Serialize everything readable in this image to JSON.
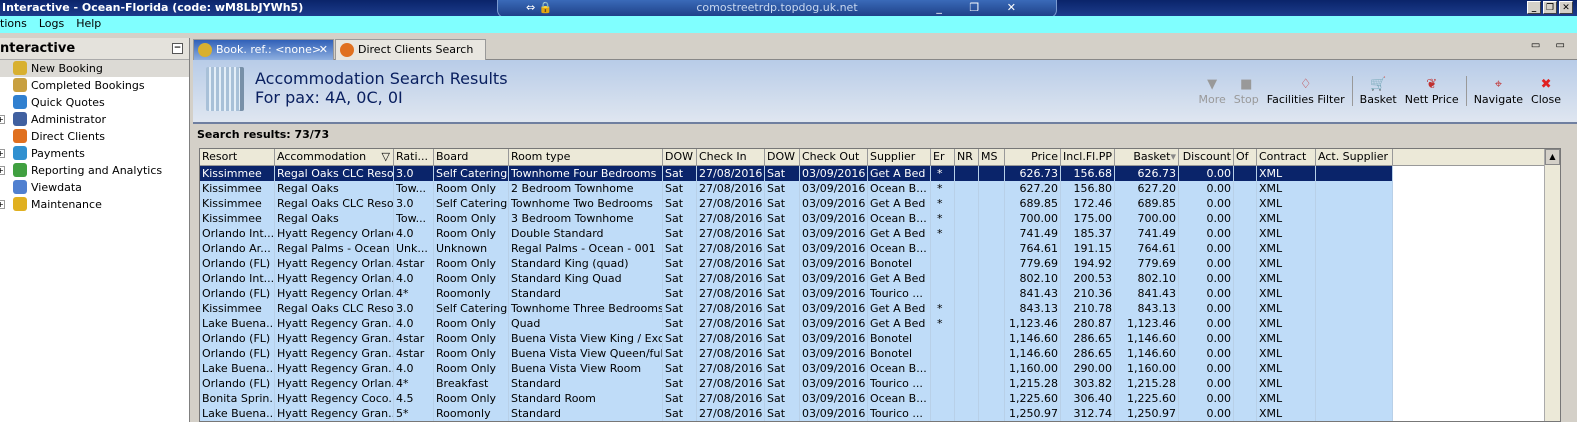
{
  "window": {
    "title": "Interactive - Ocean-Florida (code: wM8LbJYWh5)",
    "controls": [
      "_",
      "❐",
      "✕"
    ]
  },
  "rdp": {
    "host": "comostreetrdp.topdog.uk.net",
    "left": "⇔ 🔒",
    "right": "_ ❐ ✕"
  },
  "menu": [
    "tions",
    "Logs",
    "Help"
  ],
  "sidebar": {
    "title": "nteractive",
    "collapse": "−",
    "items": [
      {
        "label": "New Booking",
        "color": "#d8b030",
        "exp": false
      },
      {
        "label": "Completed Bookings",
        "color": "#c8a040",
        "exp": false
      },
      {
        "label": "Quick Quotes",
        "color": "#3080d0",
        "exp": false
      },
      {
        "label": "Administrator",
        "color": "#4060a0",
        "exp": true
      },
      {
        "label": "Direct Clients",
        "color": "#e07020",
        "exp": false
      },
      {
        "label": "Payments",
        "color": "#3090d0",
        "exp": true
      },
      {
        "label": "Reporting and Analytics",
        "color": "#40a040",
        "exp": true
      },
      {
        "label": "Viewdata",
        "color": "#5080d0",
        "exp": false
      },
      {
        "label": "Maintenance",
        "color": "#e0b020",
        "exp": true
      }
    ]
  },
  "tabs": [
    {
      "label": "Book. ref.: <none>",
      "close": "✕"
    },
    {
      "label": "Direct Clients Search"
    }
  ],
  "tab_controls": "▭ ▭",
  "header": {
    "title": "Accommodation Search Results",
    "subtitle": "For pax: 4A, 0C, 0I"
  },
  "toolbar": [
    {
      "label": "More",
      "icon": "▼",
      "disabled": true
    },
    {
      "label": "Stop",
      "icon": "■",
      "disabled": true
    },
    {
      "label": "Facilities Filter",
      "icon": "♢",
      "disabled": false,
      "sep": true
    },
    {
      "label": "Basket",
      "icon": "🛒",
      "disabled": false
    },
    {
      "label": "Nett Price",
      "icon": "❦",
      "disabled": false,
      "sep": true
    },
    {
      "label": "Navigate",
      "icon": "⌖",
      "disabled": false
    },
    {
      "label": "Close",
      "icon": "✖",
      "disabled": false,
      "color": "#e02020"
    }
  ],
  "search_results": "Search results: 73/73",
  "grid": {
    "columns": [
      "Resort",
      "Accommodation",
      "Rati...",
      "Board",
      "Room type",
      "DOW",
      "Check In",
      "DOW",
      "Check Out",
      "Supplier",
      "Er",
      "NR",
      "MS",
      "Price",
      "Incl.Fl.PP",
      "Basket",
      "Discount",
      "Of",
      "Contract",
      "Act. Supplier"
    ],
    "rows": [
      [
        "Kissimmee",
        "Regal Oaks CLC Resort",
        "3.0",
        "Self Catering",
        "Townhome Four Bedrooms",
        "Sat",
        "27/08/2016",
        "Sat",
        "03/09/2016",
        "Get A Bed",
        "*",
        "",
        "",
        "626.73",
        "156.68",
        "626.73",
        "0.00",
        "",
        "XML",
        ""
      ],
      [
        "Kissimmee",
        "Regal Oaks",
        "Tow...",
        "Room Only",
        "2 Bedroom Townhome",
        "Sat",
        "27/08/2016",
        "Sat",
        "03/09/2016",
        "Ocean B...",
        "*",
        "",
        "",
        "627.20",
        "156.80",
        "627.20",
        "0.00",
        "",
        "XML",
        ""
      ],
      [
        "Kissimmee",
        "Regal Oaks CLC Resort",
        "3.0",
        "Self Catering",
        "Townhome Two Bedrooms",
        "Sat",
        "27/08/2016",
        "Sat",
        "03/09/2016",
        "Get A Bed",
        "*",
        "",
        "",
        "689.85",
        "172.46",
        "689.85",
        "0.00",
        "",
        "XML",
        ""
      ],
      [
        "Kissimmee",
        "Regal Oaks",
        "Tow...",
        "Room Only",
        "3 Bedroom Townhome",
        "Sat",
        "27/08/2016",
        "Sat",
        "03/09/2016",
        "Ocean B...",
        "*",
        "",
        "",
        "700.00",
        "175.00",
        "700.00",
        "0.00",
        "",
        "XML",
        ""
      ],
      [
        "Orlando Int...",
        "Hyatt Regency Orlando",
        "4.0",
        "Room Only",
        "Double Standard",
        "Sat",
        "27/08/2016",
        "Sat",
        "03/09/2016",
        "Get A Bed",
        "*",
        "",
        "",
        "741.49",
        "185.37",
        "741.49",
        "0.00",
        "",
        "XML",
        ""
      ],
      [
        "Orlando Ar...",
        "Regal Palms - Ocean ...",
        "Unk...",
        "Unknown",
        "Regal Palms - Ocean - 001",
        "Sat",
        "27/08/2016",
        "Sat",
        "03/09/2016",
        "Ocean B...",
        "",
        "",
        "",
        "764.61",
        "191.15",
        "764.61",
        "0.00",
        "",
        "XML",
        ""
      ],
      [
        "Orlando (FL)",
        "Hyatt Regency Orlan...",
        "4star",
        "Room Only",
        "Standard King (quad)",
        "Sat",
        "27/08/2016",
        "Sat",
        "03/09/2016",
        "Bonotel",
        "",
        "",
        "",
        "779.69",
        "194.92",
        "779.69",
        "0.00",
        "",
        "XML",
        ""
      ],
      [
        "Orlando Int...",
        "Hyatt Regency Orlan...",
        "4.0",
        "Room Only",
        "Standard King Quad",
        "Sat",
        "27/08/2016",
        "Sat",
        "03/09/2016",
        "Get A Bed",
        "",
        "",
        "",
        "802.10",
        "200.53",
        "802.10",
        "0.00",
        "",
        "XML",
        ""
      ],
      [
        "Orlando (FL)",
        "Hyatt Regency Orlan...",
        "4*",
        "Roomonly",
        "Standard",
        "Sat",
        "27/08/2016",
        "Sat",
        "03/09/2016",
        "Tourico ...",
        "",
        "",
        "",
        "841.43",
        "210.36",
        "841.43",
        "0.00",
        "",
        "XML",
        ""
      ],
      [
        "Kissimmee",
        "Regal Oaks CLC Resort",
        "3.0",
        "Self Catering",
        "Townhome Three Bedrooms",
        "Sat",
        "27/08/2016",
        "Sat",
        "03/09/2016",
        "Get A Bed",
        "*",
        "",
        "",
        "843.13",
        "210.78",
        "843.13",
        "0.00",
        "",
        "XML",
        ""
      ],
      [
        "Lake Buena...",
        "Hyatt Regency Gran...",
        "4.0",
        "Room Only",
        "Quad",
        "Sat",
        "27/08/2016",
        "Sat",
        "03/09/2016",
        "Get A Bed",
        "*",
        "",
        "",
        "1,123.46",
        "280.87",
        "1,123.46",
        "0.00",
        "",
        "XML",
        ""
      ],
      [
        "Orlando (FL)",
        "Hyatt Regency Gran...",
        "4star",
        "Room Only",
        "Buena Vista View King / Excl...",
        "Sat",
        "27/08/2016",
        "Sat",
        "03/09/2016",
        "Bonotel",
        "",
        "",
        "",
        "1,146.60",
        "286.65",
        "1,146.60",
        "0.00",
        "",
        "XML",
        ""
      ],
      [
        "Orlando (FL)",
        "Hyatt Regency Gran...",
        "4star",
        "Room Only",
        "Buena Vista View Queen/full ...",
        "Sat",
        "27/08/2016",
        "Sat",
        "03/09/2016",
        "Bonotel",
        "",
        "",
        "",
        "1,146.60",
        "286.65",
        "1,146.60",
        "0.00",
        "",
        "XML",
        ""
      ],
      [
        "Lake Buena...",
        "Hyatt Regency Gran...",
        "4.0",
        "Room Only",
        "Buena Vista View Room",
        "Sat",
        "27/08/2016",
        "Sat",
        "03/09/2016",
        "Ocean B...",
        "",
        "",
        "",
        "1,160.00",
        "290.00",
        "1,160.00",
        "0.00",
        "",
        "XML",
        ""
      ],
      [
        "Orlando (FL)",
        "Hyatt Regency Orlan...",
        "4*",
        "Breakfast",
        "Standard",
        "Sat",
        "27/08/2016",
        "Sat",
        "03/09/2016",
        "Tourico ...",
        "",
        "",
        "",
        "1,215.28",
        "303.82",
        "1,215.28",
        "0.00",
        "",
        "XML",
        ""
      ],
      [
        "Bonita Sprin...",
        "Hyatt Regency Coco...",
        "4.5",
        "Room Only",
        "Standard Room",
        "Sat",
        "27/08/2016",
        "Sat",
        "03/09/2016",
        "Ocean B...",
        "",
        "",
        "",
        "1,225.60",
        "306.40",
        "1,225.60",
        "0.00",
        "",
        "XML",
        ""
      ],
      [
        "Lake Buena...",
        "Hyatt Regency Gran...",
        "5*",
        "Roomonly",
        "Standard",
        "Sat",
        "27/08/2016",
        "Sat",
        "03/09/2016",
        "Tourico ...",
        "",
        "",
        "",
        "1,250.97",
        "312.74",
        "1,250.97",
        "0.00",
        "",
        "XML",
        ""
      ]
    ],
    "selected_row": 0,
    "filter_icon": "▽",
    "sort_icon": "▾",
    "scroll_up": "▲"
  }
}
